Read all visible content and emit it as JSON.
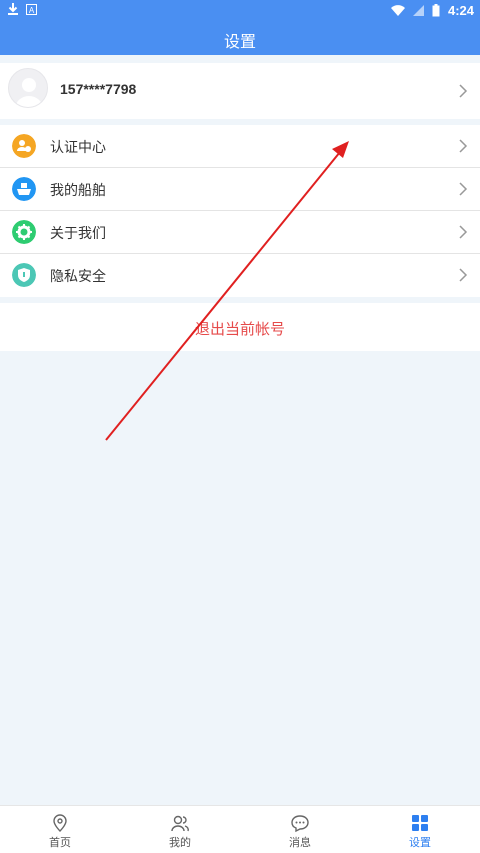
{
  "status_bar": {
    "time": "4:24"
  },
  "header": {
    "title": "设置"
  },
  "profile": {
    "phone": "157****7798",
    "avatar_icon": "avatar-icon"
  },
  "menu": {
    "items": [
      {
        "label": "认证中心",
        "icon": "certification-icon",
        "color": "#f5a623"
      },
      {
        "label": "我的船舶",
        "icon": "ship-icon",
        "color": "#2196f3"
      },
      {
        "label": "关于我们",
        "icon": "gear-icon",
        "color": "#2ecc71"
      },
      {
        "label": "隐私安全",
        "icon": "shield-icon",
        "color": "#4cc7b5"
      }
    ]
  },
  "logout": {
    "label": "退出当前帐号",
    "color": "#e64a4a"
  },
  "tabbar": {
    "tabs": [
      {
        "label": "首页",
        "icon": "location-pin-icon"
      },
      {
        "label": "我的",
        "icon": "users-icon"
      },
      {
        "label": "消息",
        "icon": "chat-icon"
      },
      {
        "label": "设置",
        "icon": "grid-icon",
        "active": true
      }
    ]
  },
  "colors": {
    "accent": "#4a8ff2",
    "active_tab": "#2d7ff0",
    "annotation_arrow": "#e02020"
  }
}
